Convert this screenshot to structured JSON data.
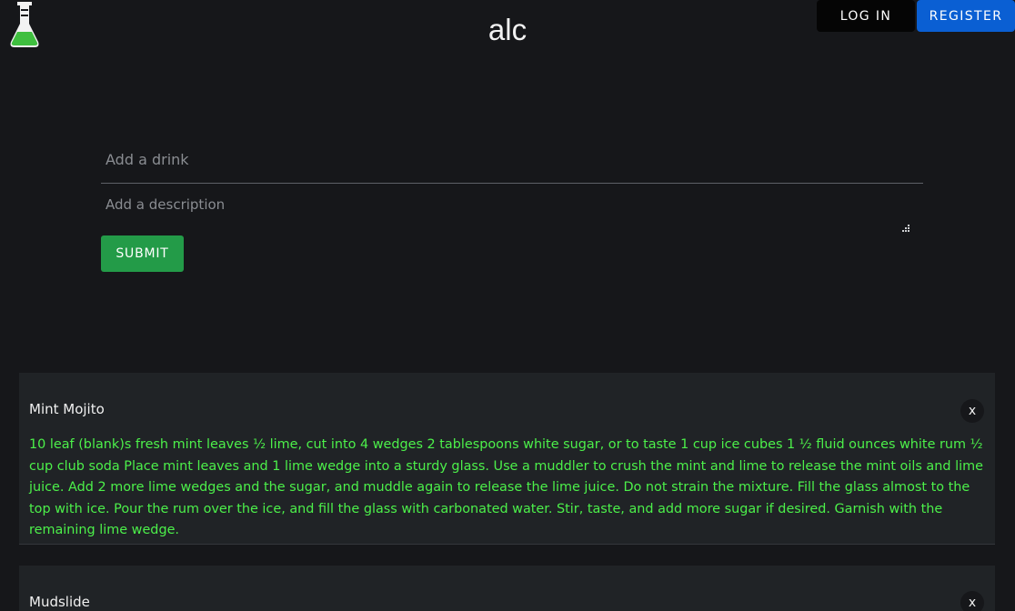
{
  "header": {
    "logo_icon": "flask-icon",
    "title": "alc",
    "login_label": "LOG IN",
    "register_label": "REGISTER",
    "colors": {
      "register": "#0a5fd3",
      "login": "#050505"
    }
  },
  "form": {
    "drink_placeholder": "Add a drink",
    "description_placeholder": "Add a description",
    "submit_label": "SUBMIT",
    "submit_color": "#239b48"
  },
  "drinks": [
    {
      "name": "Mint Mojito",
      "description": "10 leaf (blank)s fresh mint leaves ½ lime, cut into 4 wedges 2 tablespoons white sugar, or to taste 1 cup ice cubes 1 ½ fluid ounces white rum ½ cup club soda Place mint leaves and 1 lime wedge into a sturdy glass. Use a muddler to crush the mint and lime to release the mint oils and lime juice. Add 2 more lime wedges and the sugar, and muddle again to release the lime juice. Do not strain the mixture. Fill the glass almost to the top with ice. Pour the rum over the ice, and fill the glass with carbonated water. Stir, taste, and add more sugar if desired. Garnish with the remaining lime wedge.",
      "delete_label": "x"
    },
    {
      "name": "Mudslide",
      "description": "",
      "delete_label": "x"
    }
  ],
  "description_color": "#4cf04a"
}
